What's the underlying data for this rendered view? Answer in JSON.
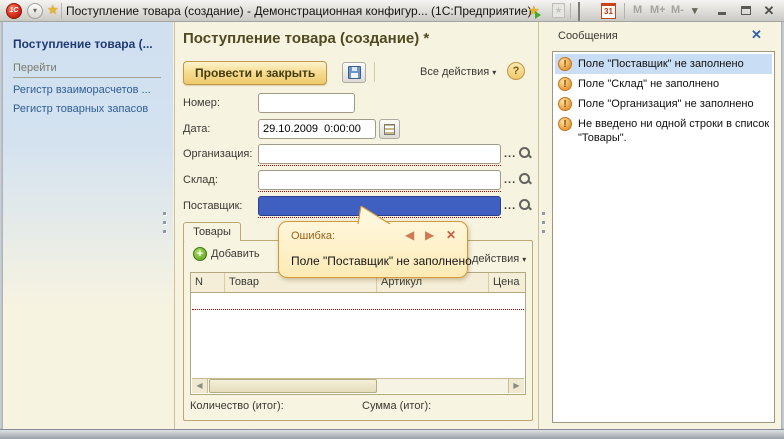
{
  "title_bar": {
    "title": "Поступление товара (создание) - Демонстрационная конфигур...  (1С:Предприятие)",
    "logo": "1С",
    "calendar_day": "31",
    "memory_buttons": [
      "M",
      "M+",
      "M-"
    ]
  },
  "sidebar": {
    "title": "Поступление товара (...",
    "nav_header": "Перейти",
    "links": [
      {
        "label": "Регистр взаиморасчетов ..."
      },
      {
        "label": "Регистр товарных запасов"
      }
    ]
  },
  "main": {
    "title": "Поступление товара (создание) *",
    "commands": {
      "post_and_close": "Провести и закрыть",
      "all_actions": "Все действия"
    },
    "fields": {
      "number": {
        "label": "Номер:",
        "value": ""
      },
      "date": {
        "label": "Дата:",
        "value": "29.10.2009  0:00:00"
      },
      "organization": {
        "label": "Организация:",
        "value": ""
      },
      "warehouse": {
        "label": "Склад:",
        "value": ""
      },
      "supplier": {
        "label": "Поставщик:",
        "value": ""
      }
    },
    "tab_label": "Товары",
    "toolbar": {
      "add": "Добавить",
      "all_actions": "Все действия"
    },
    "table": {
      "columns": [
        "N",
        "Товар",
        "Артикул",
        "Цена"
      ],
      "rows": []
    },
    "totals": {
      "quantity": "Количество (итог):",
      "sum": "Сумма (итог):"
    }
  },
  "error_tooltip": {
    "title": "Ошибка:",
    "message": "Поле \"Поставщик\" не заполнено"
  },
  "messages": {
    "title": "Сообщения",
    "items": [
      {
        "text": "Поле \"Поставщик\" не заполнено",
        "selected": true
      },
      {
        "text": "Поле \"Склад\" не заполнено",
        "selected": false
      },
      {
        "text": "Поле \"Организация\" не заполнено",
        "selected": false
      },
      {
        "text": "Не введено ни одной строки в список \"Товары\".",
        "selected": false
      }
    ]
  },
  "icons": {
    "dropdown": "▾",
    "favorites_star": "★",
    "help": "?",
    "prev": "◀",
    "next": "▶",
    "close": "✕",
    "dots": "...",
    "warning": "!",
    "add_plus": "+"
  },
  "colors": {
    "accent_gold": "#edc96d",
    "selection_blue": "#3f5fc1",
    "required_red": "#c00000",
    "warning_orange": "#e89b3a",
    "link_blue": "#2f5e96",
    "panel_blue": "#d0e0f0"
  }
}
